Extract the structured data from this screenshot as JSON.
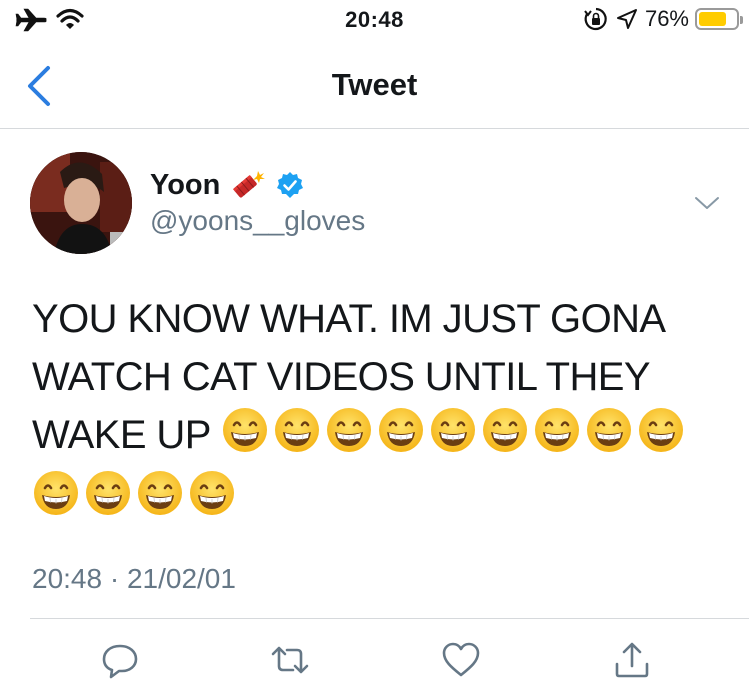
{
  "status_bar": {
    "time": "20:48",
    "battery_percent": "76%",
    "battery_level": 0.76,
    "icons": [
      "airplane-icon",
      "wifi-icon",
      "orientation-lock-icon",
      "location-icon",
      "battery-icon"
    ]
  },
  "nav": {
    "title": "Tweet",
    "back_icon": "chevron-left-icon"
  },
  "tweet": {
    "display_name": "Yoon",
    "name_emoji": "firecracker",
    "verified": true,
    "handle": "@yoons__gloves",
    "text": "YOU KNOW WHAT. IM JUST GONA WATCH CAT VIDEOS UNTIL THEY WAKE UP",
    "emoji": "grinning-face-with-smiling-eyes",
    "emoji_count": 13,
    "timestamp": "20:48 · 21/02/01"
  },
  "actions": [
    "reply-icon",
    "retweet-icon",
    "like-icon",
    "share-icon"
  ],
  "colors": {
    "accent": "#1da1f2",
    "back_arrow": "#2b7de0",
    "muted_text": "#657786",
    "battery": "#ffcc00",
    "divider": "#d6d9dc"
  }
}
